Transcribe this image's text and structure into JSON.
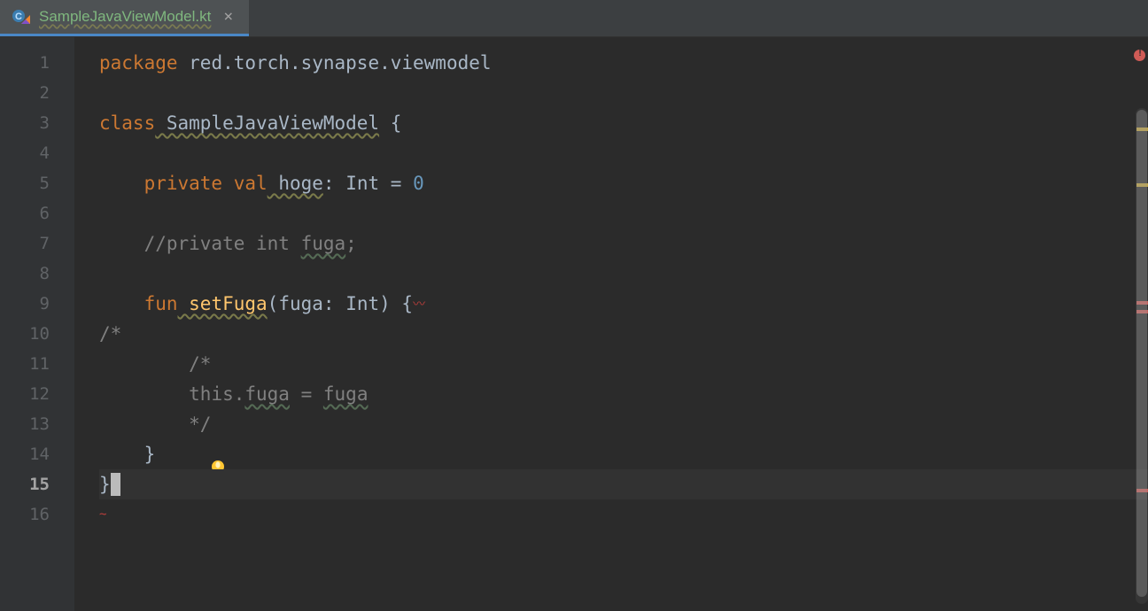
{
  "tab": {
    "title": "SampleJavaViewModel.kt",
    "close_glyph": "×"
  },
  "gutter": {
    "lines": [
      "1",
      "2",
      "3",
      "4",
      "5",
      "6",
      "7",
      "8",
      "9",
      "10",
      "11",
      "12",
      "13",
      "14",
      "15",
      "16"
    ],
    "current": 15
  },
  "code": {
    "l1_package": "package",
    "l1_pkg": " red.torch.synapse.viewmodel",
    "l3_class": "class",
    "l3_name": " SampleJavaViewModel",
    "l3_brace": " {",
    "l5_dots": "    ",
    "l5_priv": "private",
    "l5_val": " val",
    "l5_name": " hoge",
    "l5_colon": ": ",
    "l5_type": "Int",
    "l5_eq": " = ",
    "l5_num": "0",
    "l7_dots": "    ",
    "l7_comment": "//private int ",
    "l7_fuga": "fuga",
    "l7_semi": ";",
    "l9_dots": "    ",
    "l9_fun": "fun",
    "l9_name": " setFuga",
    "l9_sig1": "(fuga: ",
    "l9_type": "Int",
    "l9_sig2": ") {",
    "l9_err": " ",
    "l10_c": "/*",
    "l11_dots": "        ",
    "l11_c": "/*",
    "l12_dots": "        ",
    "l12_this": "this.",
    "l12_fuga1": "fuga",
    "l12_eq": " = ",
    "l12_fuga2": "fuga",
    "l13_dots": "        ",
    "l13_c": "*/",
    "l14_dots": "    ",
    "l14_brace": "}",
    "l15_brace": "}",
    "l16_err": "~"
  }
}
